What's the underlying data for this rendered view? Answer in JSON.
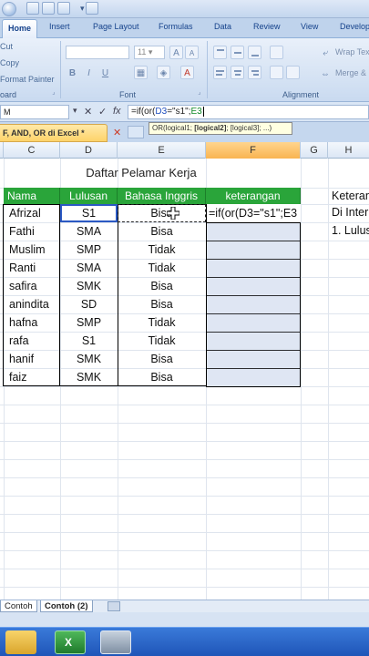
{
  "ribbon": {
    "tabs": [
      "Home",
      "Insert",
      "Page Layout",
      "Formulas",
      "Data",
      "Review",
      "View",
      "Develop"
    ],
    "active_tab": "Home",
    "clipboard": {
      "cut": "Cut",
      "copy": "Copy",
      "format_painter": "Format Painter",
      "label": "oard"
    },
    "font": {
      "size": "11",
      "label": "Font"
    },
    "alignment": {
      "wrap_text": "Wrap Tex",
      "merge": "Merge &",
      "label": "Alignment"
    }
  },
  "formula_bar": {
    "name_box": "M",
    "cancel": "✕",
    "enter": "✓",
    "fx": "fx",
    "formula_prefix": "=if(or(",
    "formula_ref1": "D3",
    "formula_mid": "=\"s1\";",
    "formula_ref2": "E3",
    "tooltip_prefix": "OR(logical1; ",
    "tooltip_bold": "[logical2]",
    "tooltip_suffix": "; [logical3]; ...)"
  },
  "document": {
    "tab_title": "F, AND, OR di Excel *",
    "close": "✕"
  },
  "columns": [
    "C",
    "D",
    "E",
    "F",
    "G",
    "H"
  ],
  "sheet": {
    "title": "Daftar Pelamar Kerja",
    "headers": {
      "nama": "Nama",
      "lulusan": "Lulusan",
      "bahasa": "Bahasa Inggris",
      "keterangan": "keterangan"
    },
    "rows": [
      {
        "nama": "Afrizal",
        "lulusan": "S1",
        "bahasa": "Bisa"
      },
      {
        "nama": "Fathi",
        "lulusan": "SMA",
        "bahasa": "Bisa"
      },
      {
        "nama": "Muslim",
        "lulusan": "SMP",
        "bahasa": "Tidak"
      },
      {
        "nama": "Ranti",
        "lulusan": "SMA",
        "bahasa": "Tidak"
      },
      {
        "nama": "safira",
        "lulusan": "SMK",
        "bahasa": "Bisa"
      },
      {
        "nama": "anindita",
        "lulusan": "SD",
        "bahasa": "Bisa"
      },
      {
        "nama": "hafna",
        "lulusan": "SMP",
        "bahasa": "Tidak"
      },
      {
        "nama": "rafa",
        "lulusan": "S1",
        "bahasa": "Tidak"
      },
      {
        "nama": "hanif",
        "lulusan": "SMK",
        "bahasa": "Bisa"
      },
      {
        "nama": "faiz",
        "lulusan": "SMK",
        "bahasa": "Bisa"
      }
    ],
    "active_cell_formula": "=if(or(D3=\"s1\";E3",
    "info_lines": [
      "Keteran",
      "Di Inter",
      "1. Lulus"
    ]
  },
  "sheet_tabs": [
    "Contoh",
    "Contoh (2)"
  ],
  "active_sheet": "Contoh (2)"
}
